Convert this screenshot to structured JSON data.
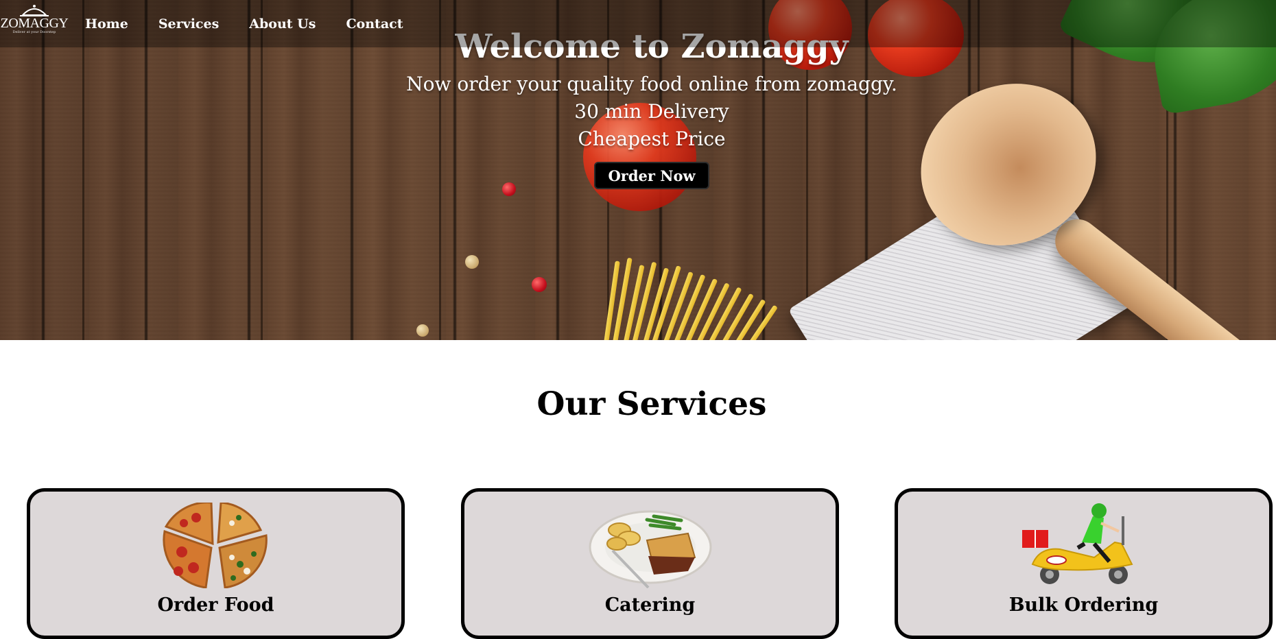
{
  "brand": {
    "name": "ZOMAGGY",
    "tagline": "Deliver at your Doorstep"
  },
  "nav": {
    "items": [
      {
        "label": "Home"
      },
      {
        "label": "Services"
      },
      {
        "label": "About Us"
      },
      {
        "label": "Contact"
      }
    ]
  },
  "hero": {
    "title": "Welcome to Zomaggy",
    "lines": [
      "Now order your quality food online from zomaggy.",
      "30 min Delivery",
      "Cheapest Price"
    ],
    "cta_label": "Order Now"
  },
  "services": {
    "heading": "Our Services",
    "cards": [
      {
        "title": "Order Food",
        "image": "pizza-slices-image"
      },
      {
        "title": "Catering",
        "image": "plated-meal-image"
      },
      {
        "title": "Bulk Ordering",
        "image": "delivery-scooter-image"
      }
    ]
  },
  "colors": {
    "nav_overlay": "#00000059",
    "button_bg": "#000000",
    "card_bg": "#ddd8d9",
    "card_border": "#000000",
    "text_light": "#ffffff"
  }
}
